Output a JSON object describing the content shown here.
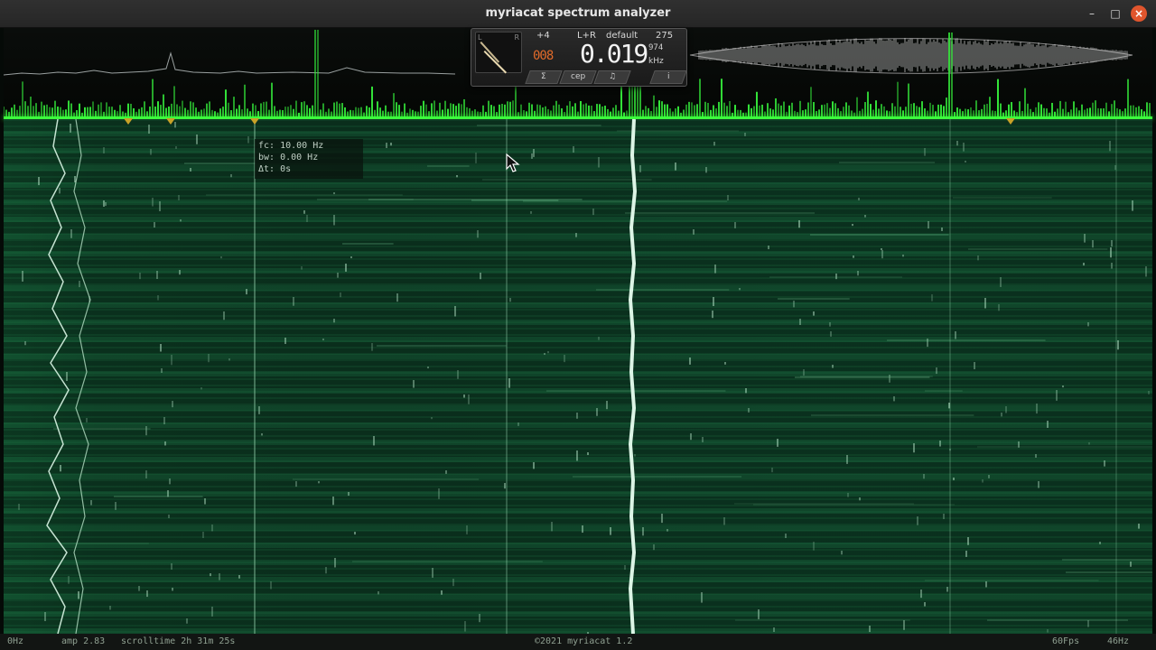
{
  "window": {
    "title": "myriacat spectrum analyzer",
    "minimize_glyph": "–",
    "maximize_glyph": "□",
    "close_glyph": "×"
  },
  "panel": {
    "meter_left_label": "L",
    "meter_right_label": "R",
    "shift": "+4",
    "channel": "L+R",
    "preset": "default",
    "preset_number": "275",
    "small_digits": "008",
    "big_value": "0.019",
    "sub_value": "974",
    "unit": "kHz",
    "tabs": [
      "Σ",
      "cep",
      "♫",
      "i"
    ]
  },
  "tooltip": {
    "fc": "fc: 10.00 Hz",
    "bw": "bw: 0.00 Hz",
    "dt": "Δt: 0s"
  },
  "status": {
    "left_freq": "0Hz",
    "amp": "amp 2.83",
    "scrolltime": "scrolltime 2h 31m 25s",
    "copyright": "©2021 myriacat 1.2",
    "fps": "60Fps",
    "right_freq": "46Hz"
  },
  "colors": {
    "spectrum_green": "#3cff3c",
    "waterfall_base": "#0b3a22",
    "marker": "#c9a227",
    "close_button": "#e0552d"
  },
  "icons": {
    "cursor": "mouse-pointer-icon"
  }
}
